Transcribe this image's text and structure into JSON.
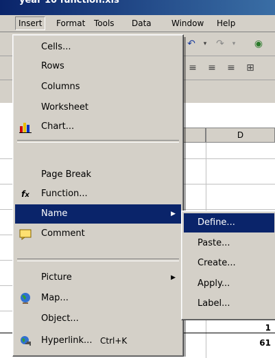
{
  "window": {
    "title": "year 10 function.xls"
  },
  "menubar": {
    "items": [
      "Insert",
      "Format",
      "Tools",
      "Data",
      "Window",
      "Help"
    ]
  },
  "insert_menu": {
    "items": [
      {
        "label": "Cells...",
        "icon": ""
      },
      {
        "label": "Rows",
        "icon": ""
      },
      {
        "label": "Columns",
        "icon": ""
      },
      {
        "label": "Worksheet",
        "icon": ""
      },
      {
        "label": "Chart...",
        "icon": "chart-icon"
      },
      {
        "label": "Page Break",
        "icon": ""
      },
      {
        "label": "Function...",
        "icon": "function-icon"
      },
      {
        "label": "Name",
        "icon": "",
        "submenu": true
      },
      {
        "label": "Comment",
        "icon": "comment-icon"
      },
      {
        "label": "Picture",
        "icon": "",
        "submenu": true
      },
      {
        "label": "Map...",
        "icon": "map-globe-icon"
      },
      {
        "label": "Object...",
        "icon": ""
      },
      {
        "label": "Hyperlink...",
        "icon": "hyperlink-icon",
        "shortcut": "Ctrl+K"
      }
    ]
  },
  "name_submenu": {
    "items": [
      "Define...",
      "Paste...",
      "Create...",
      "Apply...",
      "Label..."
    ]
  },
  "sheet": {
    "column_header": "D",
    "cells": [
      "1",
      "61"
    ]
  },
  "colors": {
    "highlight": "#0a246a",
    "face": "#d4d0c8"
  }
}
